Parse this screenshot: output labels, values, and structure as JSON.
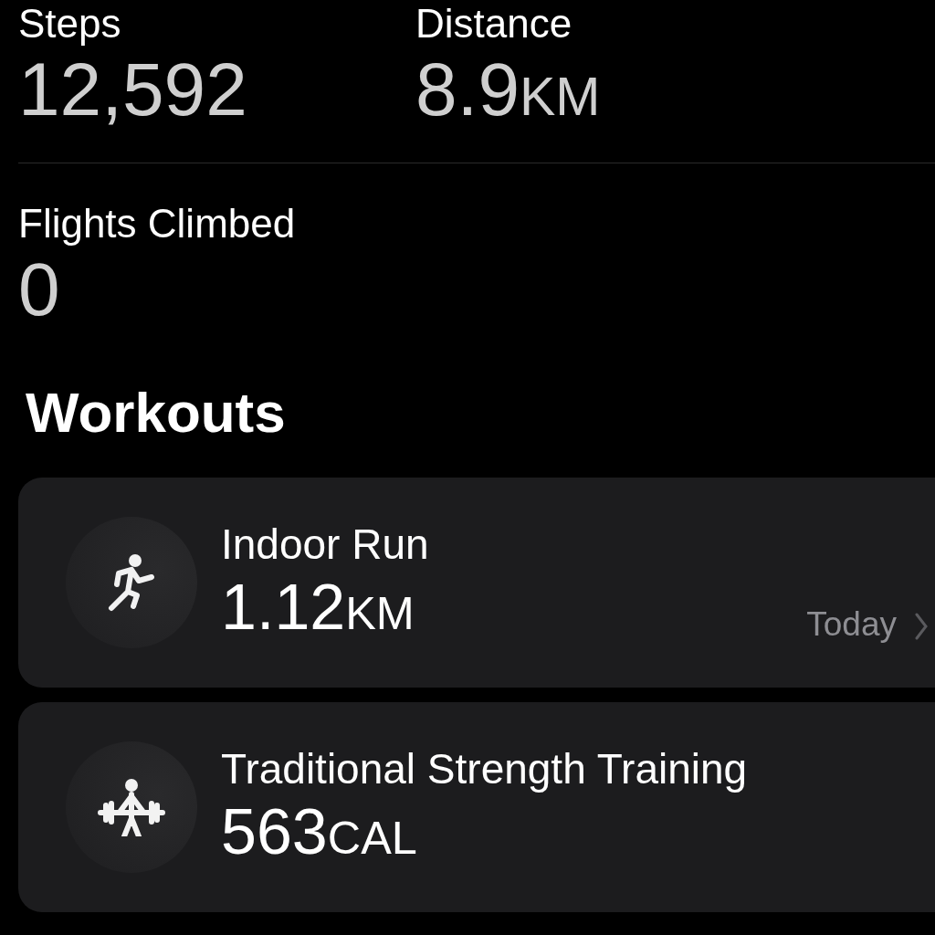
{
  "stats": [
    {
      "label": "Steps",
      "value": "12,592"
    },
    {
      "label": "Distance",
      "value": "8.9",
      "unit": "KM"
    },
    {
      "label": "Flights Climbed",
      "value": "0"
    }
  ],
  "workouts_title": "Workouts",
  "workouts": [
    {
      "kind": "run",
      "name": "Indoor Run",
      "value": "1.12",
      "unit": "KM",
      "date": "Today"
    },
    {
      "kind": "strength",
      "name": "Traditional Strength Training",
      "value": "563",
      "unit": "CAL"
    }
  ]
}
